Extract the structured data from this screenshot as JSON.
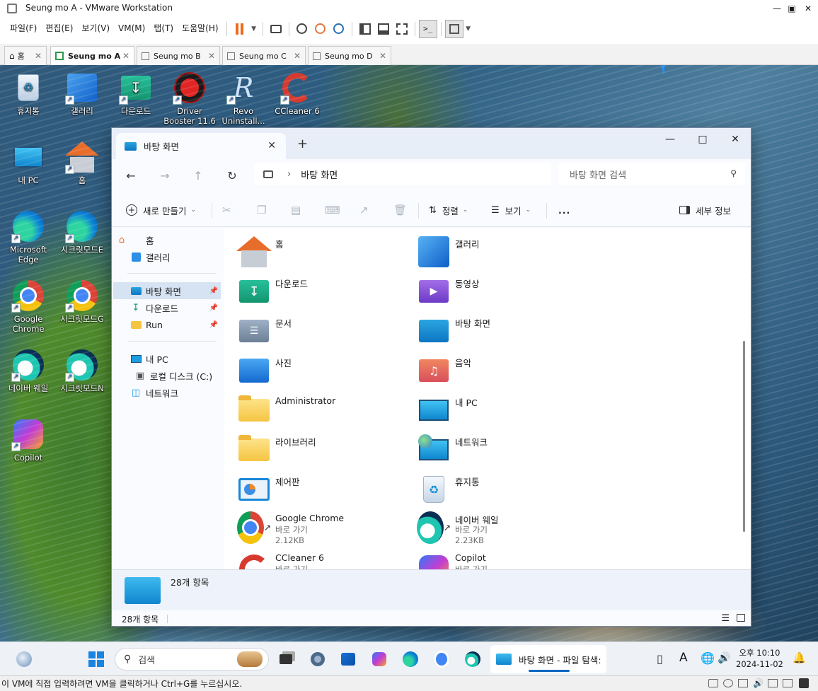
{
  "vmware": {
    "window_title": "Seung mo A - VMware Workstation",
    "menu": [
      "파일(F)",
      "편집(E)",
      "보기(V)",
      "VM(M)",
      "탭(T)",
      "도움말(H)"
    ],
    "tabs": [
      {
        "label": "홈",
        "active": false
      },
      {
        "label": "Seung mo A",
        "active": true
      },
      {
        "label": "Seung mo B",
        "active": false
      },
      {
        "label": "Seung mo C",
        "active": false
      },
      {
        "label": "Seung mo D",
        "active": false
      }
    ],
    "status_message": "이 VM에 직접 입력하려면 VM을 클릭하거나 Ctrl+G를 누르십시오."
  },
  "desktop_icons": [
    {
      "label": "휴지통",
      "icon": "recycle-bin-icon"
    },
    {
      "label": "갤러리",
      "icon": "gallery-icon"
    },
    {
      "label": "다운로드",
      "icon": "downloads-folder-icon"
    },
    {
      "label": "Driver Booster 11.6",
      "icon": "driver-booster-icon"
    },
    {
      "label": "Revo Uninstall...",
      "icon": "revo-uninstaller-icon"
    },
    {
      "label": "CCleaner 6",
      "icon": "ccleaner-icon"
    },
    {
      "label": "내 PC",
      "icon": "this-pc-icon"
    },
    {
      "label": "홈",
      "icon": "home-icon"
    },
    {
      "label": "Microsoft Edge",
      "icon": "edge-icon"
    },
    {
      "label": "시크릿모드E",
      "icon": "edge-icon"
    },
    {
      "label": "Google Chrome",
      "icon": "chrome-icon"
    },
    {
      "label": "시크릿모드G",
      "icon": "chrome-icon"
    },
    {
      "label": "네이버 웨일",
      "icon": "whale-icon"
    },
    {
      "label": "시크릿모드N",
      "icon": "whale-icon"
    },
    {
      "label": "Copilot",
      "icon": "copilot-icon"
    }
  ],
  "explorer": {
    "tab_title": "바탕 화면",
    "breadcrumb": "바탕 화면",
    "search_placeholder": "바탕 화면 검색",
    "commands": {
      "new": "새로 만들기",
      "sort": "정렬",
      "view": "보기",
      "more": "...",
      "details": "세부 정보"
    },
    "nav": {
      "home": "홈",
      "gallery": "갤러리",
      "desktop": "바탕 화면",
      "downloads": "다운로드",
      "run": "Run",
      "thispc": "내 PC",
      "localdisk": "로컬 디스크 (C:)",
      "network": "네트워크"
    },
    "items": [
      {
        "name": "홈",
        "icon": "home-icon"
      },
      {
        "name": "갤러리",
        "icon": "gallery-icon"
      },
      {
        "name": "다운로드",
        "icon": "downloads-folder-icon"
      },
      {
        "name": "동영상",
        "icon": "videos-folder-icon"
      },
      {
        "name": "문서",
        "icon": "documents-folder-icon"
      },
      {
        "name": "바탕 화면",
        "icon": "desktop-folder-icon"
      },
      {
        "name": "사진",
        "icon": "pictures-folder-icon"
      },
      {
        "name": "음악",
        "icon": "music-folder-icon"
      },
      {
        "name": "Administrator",
        "icon": "folder-icon"
      },
      {
        "name": "내 PC",
        "icon": "this-pc-icon"
      },
      {
        "name": "라이브러리",
        "icon": "folder-icon"
      },
      {
        "name": "네트워크",
        "icon": "network-icon"
      },
      {
        "name": "제어판",
        "icon": "control-panel-icon"
      },
      {
        "name": "휴지통",
        "icon": "recycle-bin-icon"
      },
      {
        "name": "Google Chrome",
        "icon": "chrome-icon",
        "type": "바로 가기",
        "size": "2.12KB"
      },
      {
        "name": "네이버 웨일",
        "icon": "whale-icon",
        "type": "바로 가기",
        "size": "2.23KB"
      },
      {
        "name": "CCleaner 6",
        "icon": "ccleaner-icon",
        "type": "바로 가기"
      },
      {
        "name": "Copilot",
        "icon": "copilot-icon",
        "type": "바로 가기"
      }
    ],
    "details_count": "28개 항목",
    "status_count": "28개 항목"
  },
  "taskbar": {
    "search_placeholder": "검색",
    "active_window": "바탕 화면 - 파일 탐색:",
    "clock_time": "오후 10:10",
    "clock_date": "2024-11-02",
    "lang_indicator": "A"
  }
}
